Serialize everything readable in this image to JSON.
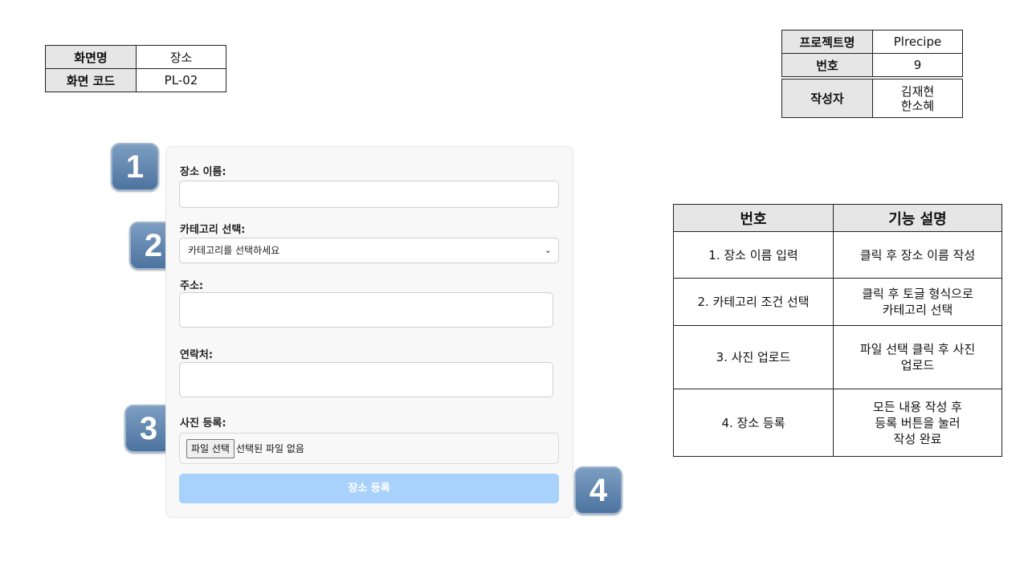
{
  "screen_info": [
    {
      "key": "화면명",
      "value": "장소"
    },
    {
      "key": "화면 코드",
      "value": "PL-02"
    }
  ],
  "project_info": {
    "project_name_label": "프로젝트명",
    "project_name": "Plrecipe",
    "number_label": "번호",
    "number": "9",
    "author_label": "작성자",
    "authors": [
      "김재현",
      "한소혜"
    ]
  },
  "badges": [
    "1",
    "2",
    "3",
    "4"
  ],
  "form": {
    "name_label": "장소 이름:",
    "name_value": "",
    "category_label": "카테고리 선택:",
    "category_selected": "카테고리를 선택하세요",
    "category_icon": "chevron-down-icon",
    "address_label": "주소:",
    "address_value": "",
    "contact_label": "연락처:",
    "contact_value": "",
    "photo_label": "사진 등록:",
    "file_button": "파일 선택",
    "file_status": "선택된 파일 없음",
    "submit_label": "장소 등록",
    "submit_color": "#a8d1fb"
  },
  "description_table": {
    "headers": [
      "번호",
      "기능 설명"
    ],
    "rows": [
      {
        "item": "1. 장소 이름 입력",
        "desc": [
          "클릭 후 장소 이름 작성"
        ]
      },
      {
        "item": "2. 카테고리 조건 선택",
        "desc": [
          "클릭 후 토글 형식으로",
          "카테고리 선택"
        ]
      },
      {
        "item": "3. 사진 업로드",
        "desc": [
          "파일 선택 클릭 후 사진",
          "업로드"
        ]
      },
      {
        "item": "4. 장소 등록",
        "desc": [
          "모든 내용 작성 후",
          "등록 버튼을 눌러",
          "작성 완료"
        ]
      }
    ]
  }
}
